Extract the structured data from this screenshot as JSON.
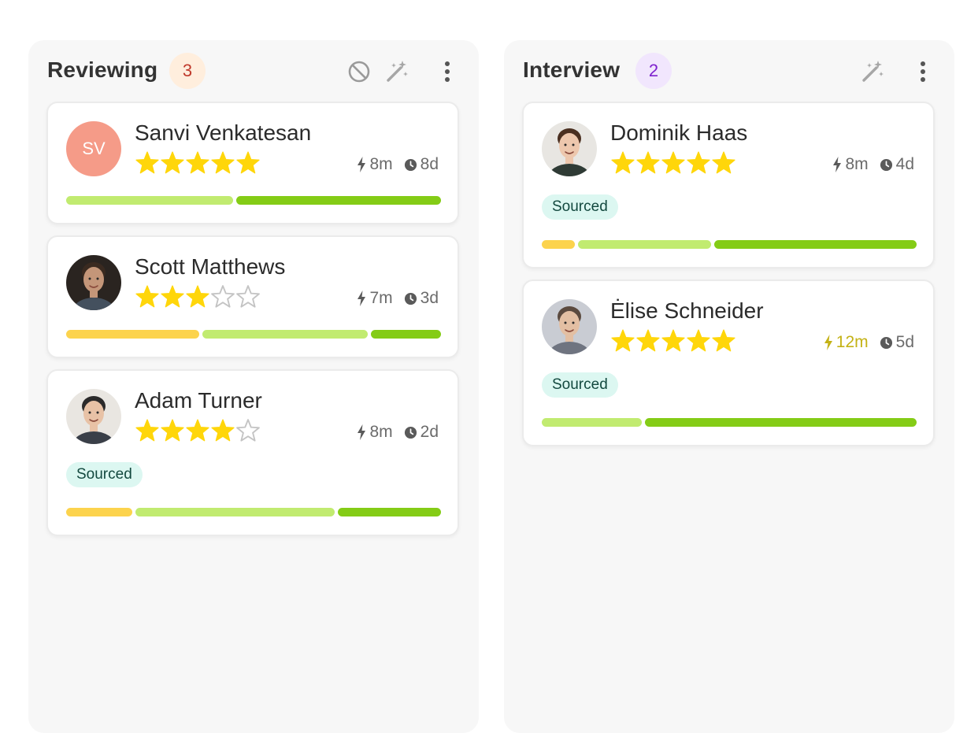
{
  "columns": [
    {
      "title": "Reviewing",
      "count": "3",
      "badge_colors": {
        "bg": "#ffeedd",
        "fg": "#c0392b"
      },
      "header_icons": [
        "block-icon",
        "magic-wand-icon",
        "more-vert-icon"
      ],
      "cards": [
        {
          "name": "Sanvi Venkatesan",
          "avatar": {
            "type": "initials",
            "text": "SV",
            "color": "#f59b88"
          },
          "rating": 5,
          "activity": "8m",
          "age": "8d",
          "tag": null,
          "bar": [
            {
              "fraction": 0.45,
              "color": "#c1eb70"
            },
            {
              "fraction": 0.55,
              "color": "#84cc16"
            }
          ]
        },
        {
          "name": "Scott Matthews",
          "avatar": {
            "type": "photo",
            "icon": "person-photo-icon"
          },
          "rating": 3,
          "activity": "7m",
          "age": "3d",
          "tag": null,
          "bar": [
            {
              "fraction": 0.36,
              "color": "#fcd34d"
            },
            {
              "fraction": 0.45,
              "color": "#c1eb70"
            },
            {
              "fraction": 0.19,
              "color": "#84cc16"
            }
          ]
        },
        {
          "name": "Adam Turner",
          "avatar": {
            "type": "photo",
            "icon": "person-photo-icon"
          },
          "rating": 4,
          "activity": "8m",
          "age": "2d",
          "tag": "Sourced",
          "bar": [
            {
              "fraction": 0.18,
              "color": "#fcd34d"
            },
            {
              "fraction": 0.54,
              "color": "#c1eb70"
            },
            {
              "fraction": 0.28,
              "color": "#84cc16"
            }
          ]
        }
      ]
    },
    {
      "title": "Interview",
      "count": "2",
      "badge_colors": {
        "bg": "#f1e6fd",
        "fg": "#7e22ce"
      },
      "header_icons": [
        "magic-wand-icon",
        "more-vert-icon"
      ],
      "cards": [
        {
          "name": "Dominik Haas",
          "avatar": {
            "type": "photo",
            "icon": "person-photo-icon"
          },
          "rating": 5,
          "activity": "8m",
          "age": "4d",
          "tag": "Sourced",
          "bar": [
            {
              "fraction": 0.09,
              "color": "#fcd34d"
            },
            {
              "fraction": 0.36,
              "color": "#c1eb70"
            },
            {
              "fraction": 0.55,
              "color": "#84cc16"
            }
          ]
        },
        {
          "name": "Ėlise Schneider",
          "avatar": {
            "type": "photo",
            "icon": "person-photo-icon"
          },
          "rating": 5,
          "activity": "12m",
          "activity_warning": true,
          "age": "5d",
          "tag": "Sourced",
          "bar": [
            {
              "fraction": 0.27,
              "color": "#c1eb70"
            },
            {
              "fraction": 0.73,
              "color": "#84cc16"
            }
          ]
        }
      ]
    }
  ],
  "colors": {
    "star_filled": "#ffd60a",
    "star_empty": "#c4c4c4",
    "tag_bg": "#dcf7f1",
    "tag_fg": "#13493f",
    "warning_text": "#c4b216"
  }
}
